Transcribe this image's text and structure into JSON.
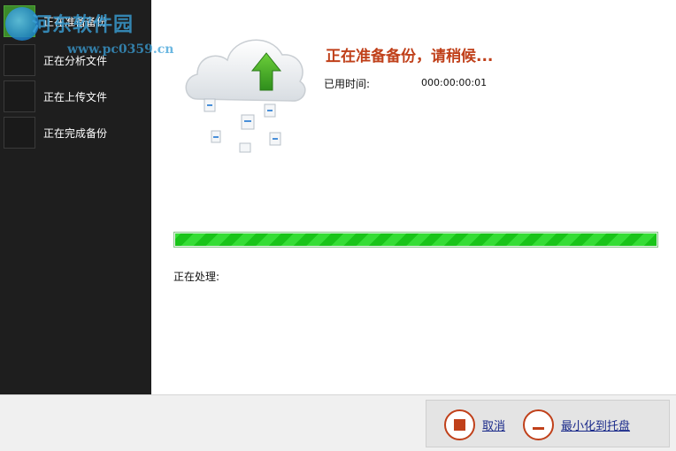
{
  "sidebar": {
    "steps": [
      {
        "label": "正在准备备份",
        "active": true
      },
      {
        "label": "正在分析文件",
        "active": false
      },
      {
        "label": "正在上传文件",
        "active": false
      },
      {
        "label": "正在完成备份",
        "active": false
      }
    ]
  },
  "watermark": {
    "title": "河东软件园",
    "url": "www.pc0359.cn"
  },
  "main": {
    "status_title": "正在准备备份，请稍候...",
    "elapsed_label": "已用时间:",
    "elapsed_value": "000:00:00:01",
    "progress_fraction": 1.0,
    "processing_label": "正在处理:"
  },
  "footer": {
    "cancel_label": "取消",
    "minimize_label": "最小化到托盘"
  },
  "colors": {
    "accent_red": "#c0401a",
    "progress_green": "#19c419",
    "link_blue": "#1a2a8a",
    "sidebar_bg": "#1e1e1e"
  },
  "icons": [
    "cloud-upload-icon",
    "document-icon",
    "stop-icon",
    "minimize-icon"
  ]
}
